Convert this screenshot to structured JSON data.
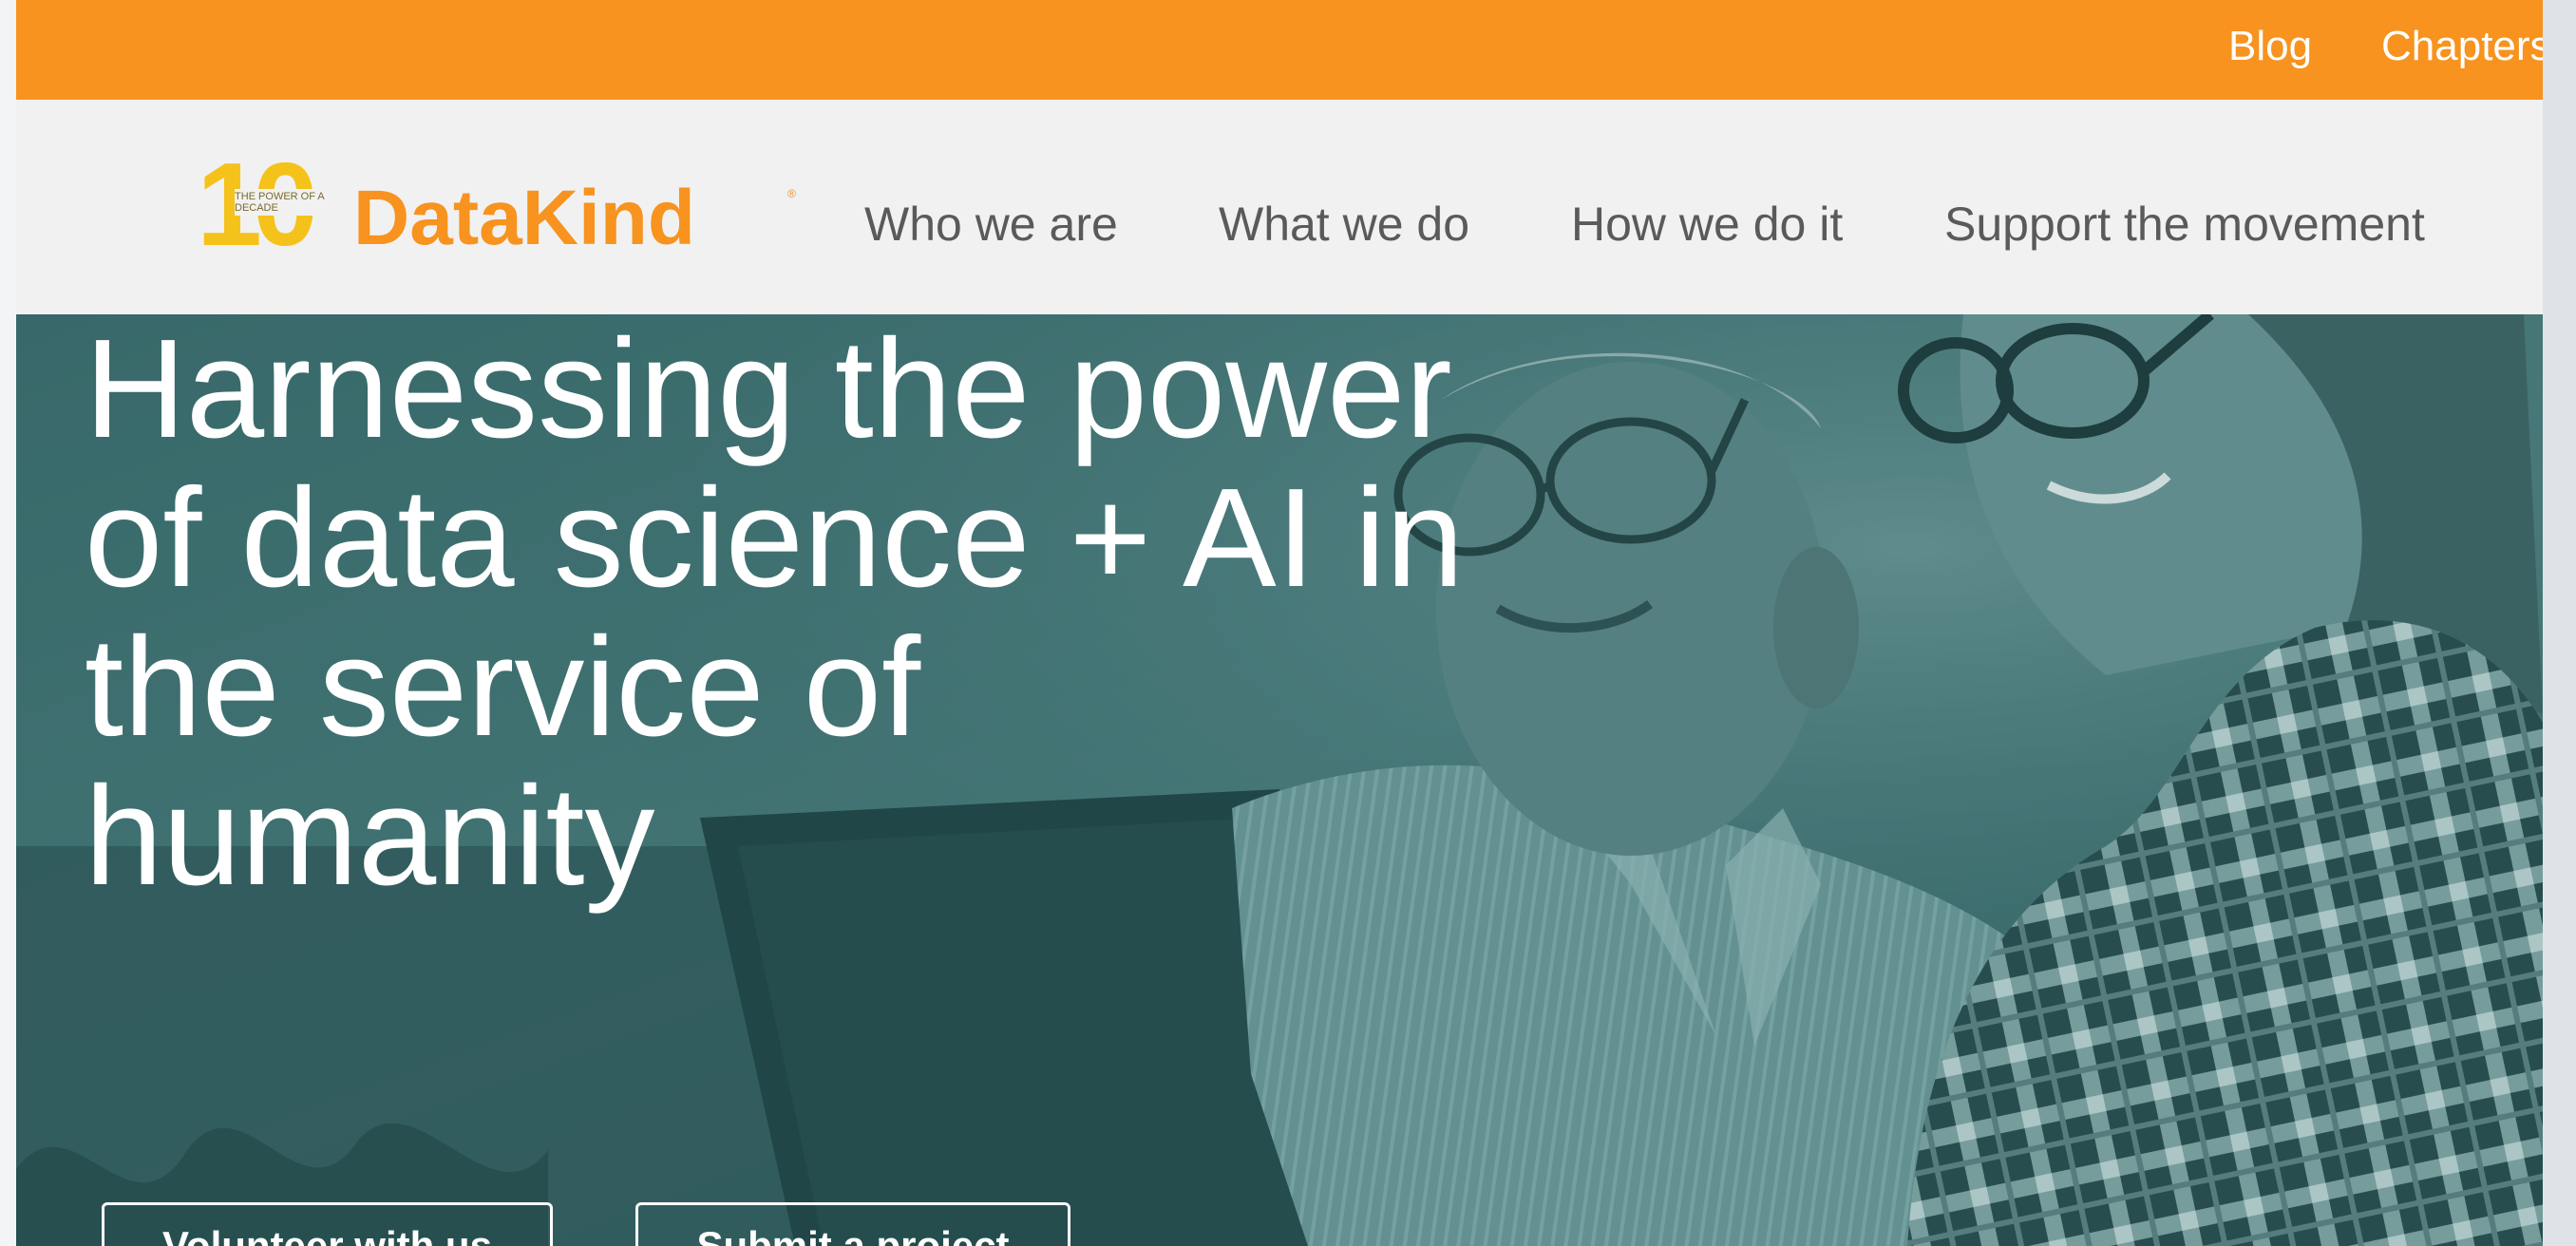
{
  "utility_bar": {
    "links": [
      "Blog",
      "Chapters"
    ]
  },
  "header": {
    "logo": {
      "anniversary_number": "10",
      "anniversary_tagline": "THE POWER OF A DECADE",
      "brand_name": "DataKind",
      "registered_mark": "®"
    },
    "nav": [
      "Who we are",
      "What we do",
      "How we do it",
      "Support the movement"
    ]
  },
  "hero": {
    "title": "Harnessing the power of data science + AI in the service of humanity",
    "buttons": [
      "Volunteer with us",
      "Submit a project"
    ]
  },
  "colors": {
    "brand_orange": "#f7931e",
    "logo_gold": "#f4c21a",
    "hero_teal": "#355f60",
    "nav_text": "#5a5a5a",
    "header_bg": "#f1f1f2"
  }
}
